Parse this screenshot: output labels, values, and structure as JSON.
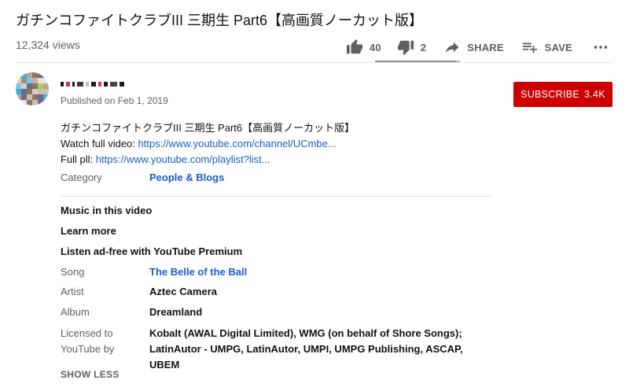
{
  "video": {
    "title": "ガチンコファイトクラブIII 三期生 Part6【高画質ノーカット版】",
    "views": "12,324 views"
  },
  "actions": {
    "like_count": "40",
    "dislike_count": "2",
    "share_label": "SHARE",
    "save_label": "SAVE",
    "like_ratio": 0.95,
    "icons": {
      "like": "thumbs-up-icon",
      "dislike": "thumbs-down-icon",
      "share": "share-arrow-icon",
      "save": "playlist-add-icon",
      "more": "more-horizontal-icon"
    }
  },
  "owner": {
    "published": "Published on Feb 1, 2019",
    "subscribe_label": "SUBSCRIBE",
    "subscriber_count": "3.4K",
    "subscribe_color": "#cc0000"
  },
  "description": {
    "line1": "ガチンコファイトクラブIII 三期生 Part6【高画質ノーカット版】",
    "line2_prefix": "Watch full video: ",
    "line2_link": "https://www.youtube.com/channel/UCmbe...",
    "line3_prefix": "Full pll: ",
    "line3_link": "https://www.youtube.com/playlist?list..."
  },
  "metadata": {
    "category_label": "Category",
    "category_value": "People & Blogs",
    "music_heading": "Music in this video",
    "learn_more": "Learn more",
    "premium_line": "Listen ad-free with YouTube Premium",
    "song_label": "Song",
    "song_value": "The Belle of the Ball",
    "artist_label": "Artist",
    "artist_value": "Aztec Camera",
    "album_label": "Album",
    "album_value": "Dreamland",
    "licensed_label": "Licensed to YouTube by",
    "licensed_value": "Kobalt (AWAL Digital Limited), WMG (on behalf of Shore Songs); LatinAutor - UMPG, LatinAutor, UMPI, UMPG Publishing, ASCAP, UBEM",
    "show_less": "SHOW LESS"
  },
  "colors": {
    "link": "#1a5bc7",
    "secondary_text": "#606060"
  }
}
